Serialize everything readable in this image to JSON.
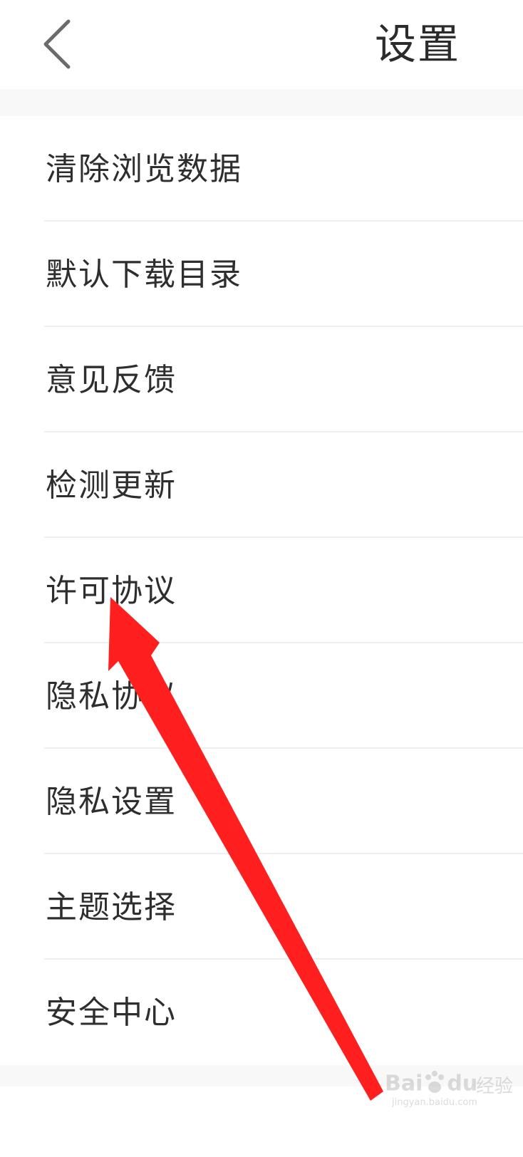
{
  "header": {
    "title": "设置",
    "back_icon": "chevron-left-icon"
  },
  "menu": {
    "items": [
      {
        "label": "清除浏览数据"
      },
      {
        "label": "默认下载目录"
      },
      {
        "label": "意见反馈"
      },
      {
        "label": "检测更新"
      },
      {
        "label": "许可协议"
      },
      {
        "label": "隐私协议"
      },
      {
        "label": "隐私设置"
      },
      {
        "label": "主题选择"
      },
      {
        "label": "安全中心"
      }
    ]
  },
  "annotation": {
    "arrow_color": "#ff1f1f",
    "points_to": "许可协议"
  },
  "watermark": {
    "brand": "Bai",
    "brand_suffix": "du",
    "cn": "经验",
    "domain": "jingyan.baidu.com"
  },
  "colors": {
    "text": "#2e2e2e",
    "divider": "#efefef",
    "section_gap": "#f8f8f8",
    "icon": "#6b6b6b"
  }
}
